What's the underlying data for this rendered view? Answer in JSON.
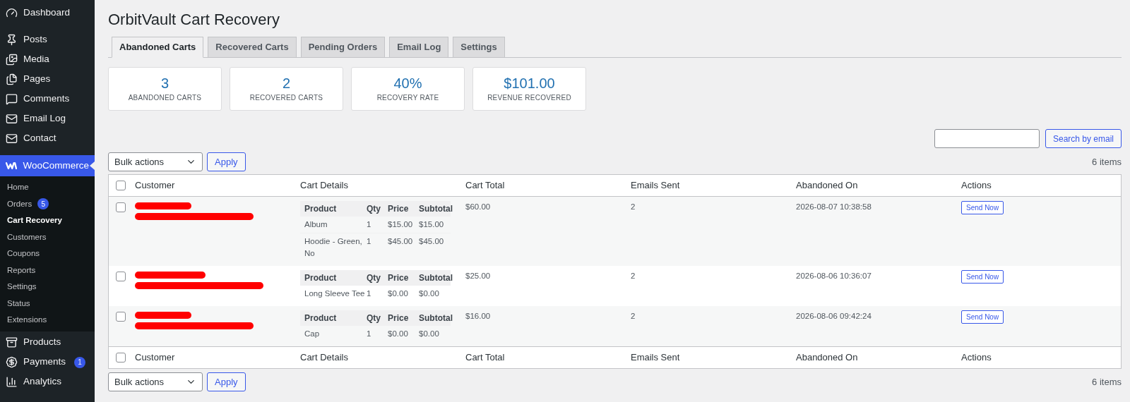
{
  "sidebar": {
    "items": [
      {
        "label": "Dashboard"
      },
      {
        "label": "Posts"
      },
      {
        "label": "Media"
      },
      {
        "label": "Pages"
      },
      {
        "label": "Comments"
      },
      {
        "label": "Email Log"
      },
      {
        "label": "Contact"
      }
    ],
    "active": {
      "label": "WooCommerce",
      "selected": true,
      "submenu": [
        {
          "label": "Home",
          "selected": false
        },
        {
          "label": "Orders",
          "selected": false,
          "badge": "5"
        },
        {
          "label": "Cart Recovery",
          "selected": true
        },
        {
          "label": "Customers",
          "selected": false
        },
        {
          "label": "Coupons",
          "selected": false
        },
        {
          "label": "Reports",
          "selected": false
        },
        {
          "label": "Settings",
          "selected": false
        },
        {
          "label": "Status",
          "selected": false
        },
        {
          "label": "Extensions",
          "selected": false
        }
      ]
    },
    "items_after": [
      {
        "label": "Products"
      },
      {
        "label": "Payments",
        "badge": "1"
      },
      {
        "label": "Analytics"
      }
    ]
  },
  "page": {
    "title": "OrbitVault Cart Recovery"
  },
  "tabs": [
    {
      "label": "Abandoned Carts",
      "selected": true
    },
    {
      "label": "Recovered Carts",
      "selected": false
    },
    {
      "label": "Pending Orders",
      "selected": false
    },
    {
      "label": "Email Log",
      "selected": false
    },
    {
      "label": "Settings",
      "selected": false
    }
  ],
  "stats": [
    {
      "value": "3",
      "label": "ABANDONED CARTS"
    },
    {
      "value": "2",
      "label": "RECOVERED CARTS"
    },
    {
      "value": "40%",
      "label": "RECOVERY RATE"
    },
    {
      "value": "$101.00",
      "label": "REVENUE RECOVERED"
    }
  ],
  "search": {
    "button": "Search by email"
  },
  "top_nav": {
    "bulk": "Bulk actions",
    "apply": "Apply",
    "count": "6 items"
  },
  "bottom_nav": {
    "bulk": "Bulk actions",
    "apply": "Apply",
    "count": "6 items"
  },
  "table": {
    "header_checked": false,
    "footer_checked": false,
    "columns": [
      "Customer",
      "Cart Details",
      "Cart Total",
      "Emails Sent",
      "Abandoned On",
      "Actions"
    ],
    "footer_columns": [
      "Customer",
      "Cart Details",
      "Cart Total",
      "Emails Sent",
      "Abandoned On",
      "Actions"
    ],
    "rows": [
      {
        "checked": false,
        "redacted": true,
        "cart_columns": [
          "Product",
          "Qty",
          "Price",
          "Subtotal"
        ],
        "items": [
          [
            "Album",
            "1",
            "$15.00",
            "$15.00"
          ],
          [
            "Hoodie - Green, No",
            "1",
            "$45.00",
            "$45.00"
          ]
        ],
        "total": "$60.00",
        "emails_sent": "2",
        "abandoned_on": "2026-08-07 10:38:58",
        "action": "Send Now"
      },
      {
        "checked": false,
        "redacted": true,
        "cart_columns": [
          "Product",
          "Qty",
          "Price",
          "Subtotal"
        ],
        "items": [
          [
            "Long Sleeve Tee",
            "1",
            "$0.00",
            "$0.00"
          ]
        ],
        "total": "$25.00",
        "emails_sent": "2",
        "abandoned_on": "2026-08-06 10:36:07",
        "action": "Send Now"
      },
      {
        "checked": false,
        "redacted": true,
        "cart_columns": [
          "Product",
          "Qty",
          "Price",
          "Subtotal"
        ],
        "items": [
          [
            "Cap",
            "1",
            "$0.00",
            "$0.00"
          ]
        ],
        "total": "$16.00",
        "emails_sent": "2",
        "abandoned_on": "2026-08-06 09:42:24",
        "action": "Send Now"
      }
    ]
  }
}
